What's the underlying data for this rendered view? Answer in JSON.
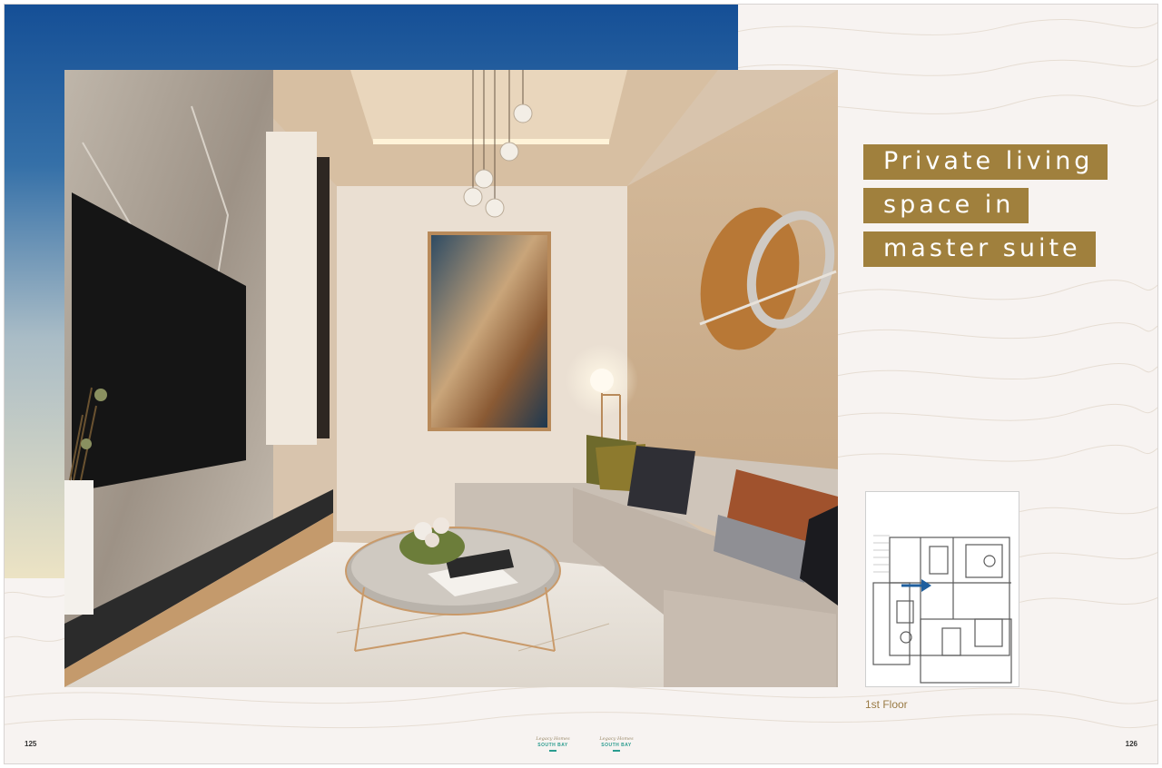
{
  "headline": {
    "lines": [
      "Private living",
      "space in",
      "master suite"
    ],
    "highlight_color": "#a0803d"
  },
  "floorplan": {
    "label": "1st Floor",
    "marker": "arrow-right-icon",
    "marker_color": "#1f5f9e"
  },
  "pages": {
    "left_number": "125",
    "right_number": "126"
  },
  "logos": {
    "left": {
      "script": "Legacy Homes",
      "brand": "SOUTH BAY"
    },
    "right": {
      "script": "Legacy Homes",
      "brand": "SOUTH BAY"
    }
  },
  "colors": {
    "gradient_top": "#154f96",
    "gradient_bottom": "#ece3c4",
    "paper": "#f7f3f1"
  }
}
